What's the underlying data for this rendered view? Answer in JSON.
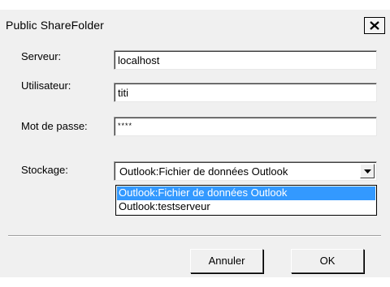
{
  "window": {
    "title": "Public ShareFolder",
    "close_icon": "close-icon"
  },
  "form": {
    "server_label": "Serveur:",
    "server_value": "localhost",
    "user_label": "Utilisateur:",
    "user_value": "titi",
    "password_label": "Mot de passe:",
    "password_value": "****",
    "storage_label": "Stockage:",
    "storage_selected": "Outlook:Fichier de données Outlook",
    "storage_options": [
      "Outlook:Fichier de données Outlook",
      "Outlook:testserveur"
    ]
  },
  "buttons": {
    "cancel_label": "Annuler",
    "ok_label": "OK"
  },
  "colors": {
    "dialog_bg": "#f0f0f0",
    "selection": "#3399ff"
  }
}
